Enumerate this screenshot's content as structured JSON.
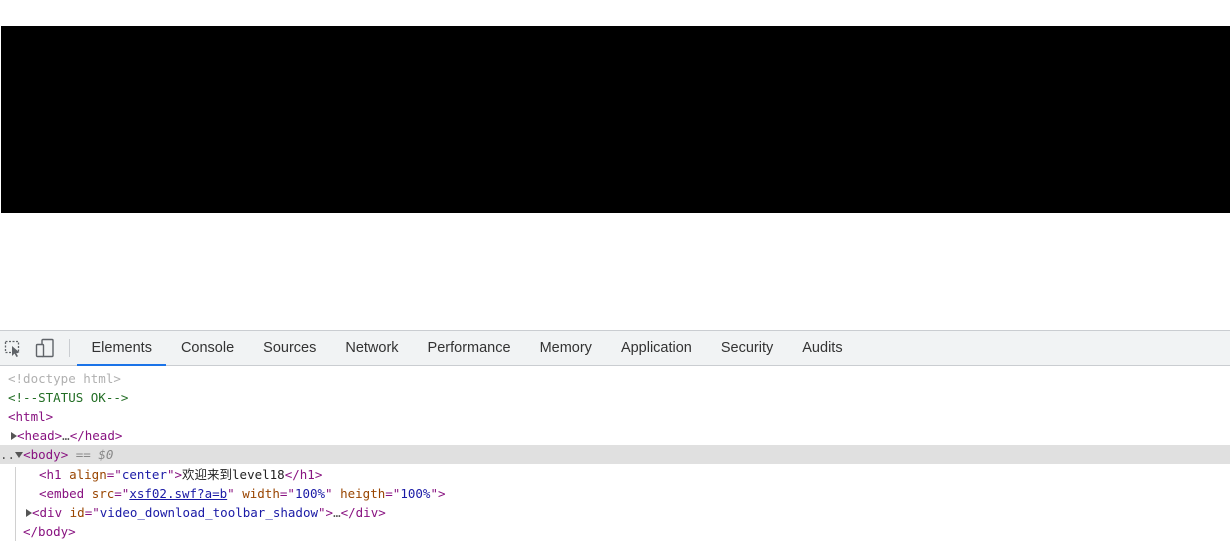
{
  "devtools": {
    "tabs": [
      {
        "label": "Elements",
        "active": true
      },
      {
        "label": "Console"
      },
      {
        "label": "Sources"
      },
      {
        "label": "Network"
      },
      {
        "label": "Performance"
      },
      {
        "label": "Memory"
      },
      {
        "label": "Application"
      },
      {
        "label": "Security"
      },
      {
        "label": "Audits"
      }
    ],
    "icons": [
      "inspect-element-icon",
      "device-toolbar-icon"
    ],
    "accent_color": "#1a73e8"
  },
  "dom": {
    "doctype": "<!doctype html>",
    "comment": "<!--STATUS OK-->",
    "html_open": "<html>",
    "head_open": "<head>",
    "head_ellipsis": "…",
    "head_close": "</head>",
    "body_open": "<body>",
    "body_marker": " == $0",
    "row_dots": "..",
    "h1": {
      "tag_open": "<h1 ",
      "attr_name": "align",
      "eq_quote": "=\"",
      "attr_value": "center",
      "close_quote": "\">",
      "text": "欢迎来到level18",
      "tag_close": "</h1>"
    },
    "embed": {
      "tag_open": "<embed ",
      "src_name": "src",
      "src_value": "xsf02.swf?a=b",
      "width_name": "width",
      "width_value": "100%",
      "heigth_name": "heigth",
      "heigth_value": "100%",
      "end": "\">"
    },
    "div": {
      "tag_open": "<div ",
      "attr_name": "id",
      "attr_value": "video_download_toolbar_shadow",
      "ellipsis": "…",
      "tag_close": "</div>"
    },
    "body_close": "</body>"
  }
}
